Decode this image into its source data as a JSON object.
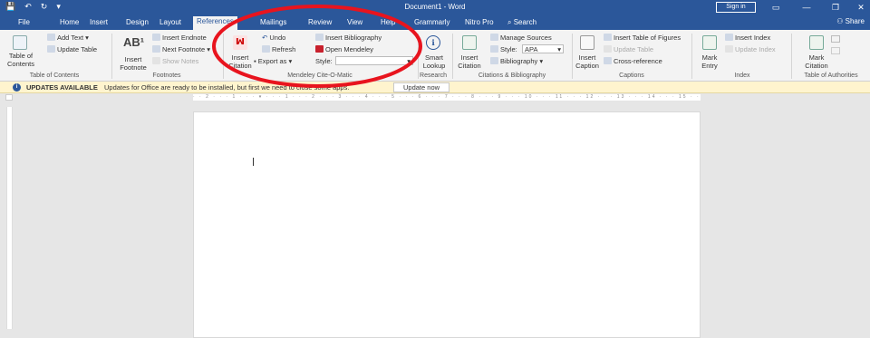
{
  "titlebar": {
    "quick_access": [
      "💾",
      "↶",
      "↻",
      "▾"
    ],
    "doc_title": "Document1 - Word",
    "signin": "Sign in",
    "window_controls": [
      "▭",
      "—",
      "❐",
      "✕"
    ]
  },
  "tabs": [
    "File",
    "Home",
    "Insert",
    "Design",
    "Layout",
    "References",
    "Mailings",
    "Review",
    "View",
    "Help",
    "Grammarly",
    "Nitro Pro",
    "Search"
  ],
  "active_tab": "References",
  "share": "Share",
  "ribbon": {
    "toc": {
      "big": "Table of Contents",
      "add_text": "Add Text",
      "update_table": "Update Table",
      "group": "Table of Contents"
    },
    "footnotes": {
      "big": "Insert Footnote",
      "insert_endnote": "Insert Endnote",
      "next_footnote": "Next Footnote",
      "show_notes": "Show Notes",
      "group": "Footnotes"
    },
    "mendeley": {
      "insert_citation": "Insert Citation",
      "undo": "Undo",
      "refresh": "Refresh",
      "export_as": "Export as",
      "insert_bibliography": "Insert Bibliography",
      "open_mendeley": "Open Mendeley",
      "style_label": "Style:",
      "group": "Mendeley Cite-O-Matic"
    },
    "research": {
      "big": "Smart Lookup",
      "group": "Research"
    },
    "citations": {
      "big": "Insert Citation",
      "manage_sources": "Manage Sources",
      "style_label": "Style:",
      "style_value": "APA",
      "bibliography": "Bibliography",
      "group": "Citations & Bibliography"
    },
    "captions": {
      "big": "Insert Caption",
      "insert_tof": "Insert Table of Figures",
      "update_table": "Update Table",
      "cross_reference": "Cross-reference",
      "group": "Captions"
    },
    "index": {
      "big": "Mark Entry",
      "insert_index": "Insert Index",
      "update_index": "Update Index",
      "group": "Index"
    },
    "authorities": {
      "big": "Mark Citation",
      "group": "Table of Authorities"
    }
  },
  "infobar": {
    "title": "UPDATES AVAILABLE",
    "message": "Updates for Office are ready to be installed, but first we need to close some apps.",
    "button": "Update now"
  },
  "ruler_text": "· · 2 · · · 1 · · · ▾ · · · 1 · · · 2 · · · 3 · · · 4 · · · 5 · · · 6 · · · 7 · · · 8 · · · 9 · · · 10 · · · 11 · · · 12 · · · 13 · · · 14 · · · 15 · · · 16 · · · 17 · · · 18",
  "colors": {
    "word_blue": "#2b579a",
    "annotation_red": "#e8141e",
    "info_yellow": "#fff4ce"
  }
}
